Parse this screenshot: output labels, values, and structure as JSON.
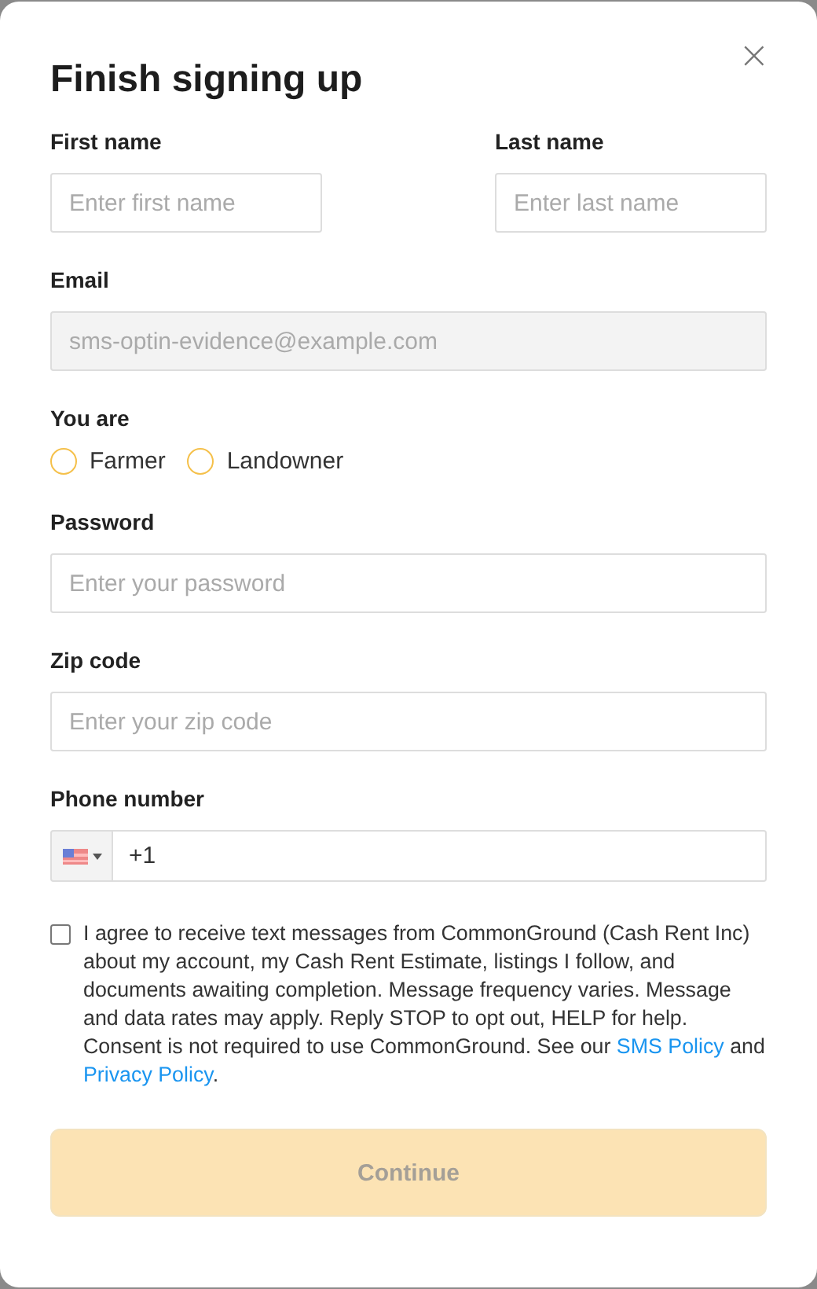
{
  "dialog": {
    "title": "Finish signing up",
    "close": "×"
  },
  "name_fields": [
    {
      "label": "First name",
      "placeholder": "Enter first name"
    },
    {
      "label": "Last name",
      "placeholder": "Enter last name"
    }
  ],
  "email": {
    "label": "Email",
    "value": "sms-optin-evidence@example.com",
    "disabled": true
  },
  "role": {
    "label": "You are",
    "options": [
      {
        "label": "Farmer",
        "selected": false
      },
      {
        "label": "Landowner",
        "selected": false
      }
    ]
  },
  "fields": [
    {
      "label": "Password",
      "placeholder": "Enter your password"
    },
    {
      "label": "Zip code",
      "placeholder": "Enter your zip code"
    }
  ],
  "phone": {
    "label": "Phone number",
    "value": "+1"
  },
  "consent": {
    "checked": false,
    "text": "I agree to receive text messages from CommonGround (Cash Rent Inc) about my account, my Cash Rent Estimate, listings I follow, and documents awaiting completion. Message frequency varies. Message and data rates may apply. Reply STOP to opt out, HELP for help. Consent is not required to use CommonGround. See our ",
    "links": [
      {
        "text": "SMS Policy"
      },
      {
        "text": "Privacy Policy"
      }
    ],
    "joiner": " and ",
    "end": "."
  },
  "continue_button": {
    "label": "Continue",
    "disabled": true
  }
}
